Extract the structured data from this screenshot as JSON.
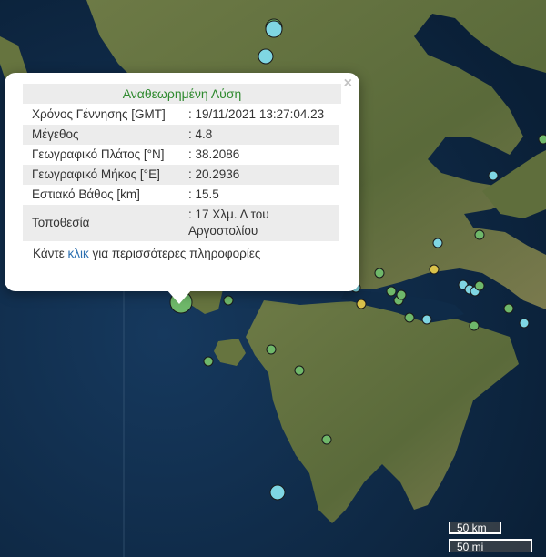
{
  "popup": {
    "title": "Αναθεωρημένη Λύση",
    "close_icon": "×",
    "rows": [
      {
        "label": "Χρόνος Γέννησης [GMT]",
        "value": ": 19/11/2021 13:27:04.23"
      },
      {
        "label": "Μέγεθος",
        "value": ": 4.8"
      },
      {
        "label": "Γεωγραφικό Πλάτος [°N]",
        "value": ": 38.2086"
      },
      {
        "label": "Γεωγραφικό Μήκος [°E]",
        "value": ": 20.2936"
      },
      {
        "label": "Εστιακό Βάθος [km]",
        "value": ": 15.5"
      },
      {
        "label": "Τοποθεσία",
        "value": ": 17 Χλμ. Δ του Αργοστολίου"
      }
    ],
    "more_prefix": "Κάντε",
    "more_link": "κλικ",
    "more_suffix": "για περισσότερες πληροφορίες"
  },
  "scale": {
    "km": "50 km",
    "mi": "50 mi"
  },
  "colors": {
    "sea": "#0d2742",
    "land": "#5b6a3a",
    "marker_green": "#6fb86a",
    "marker_cyan": "#7fd6e3",
    "marker_yellow": "#d9c24a",
    "highlight_title": "#2f8a2f"
  },
  "marker_types": [
    "recent-event (cyan)",
    "older-event (green)",
    "medium-event (yellow)"
  ]
}
